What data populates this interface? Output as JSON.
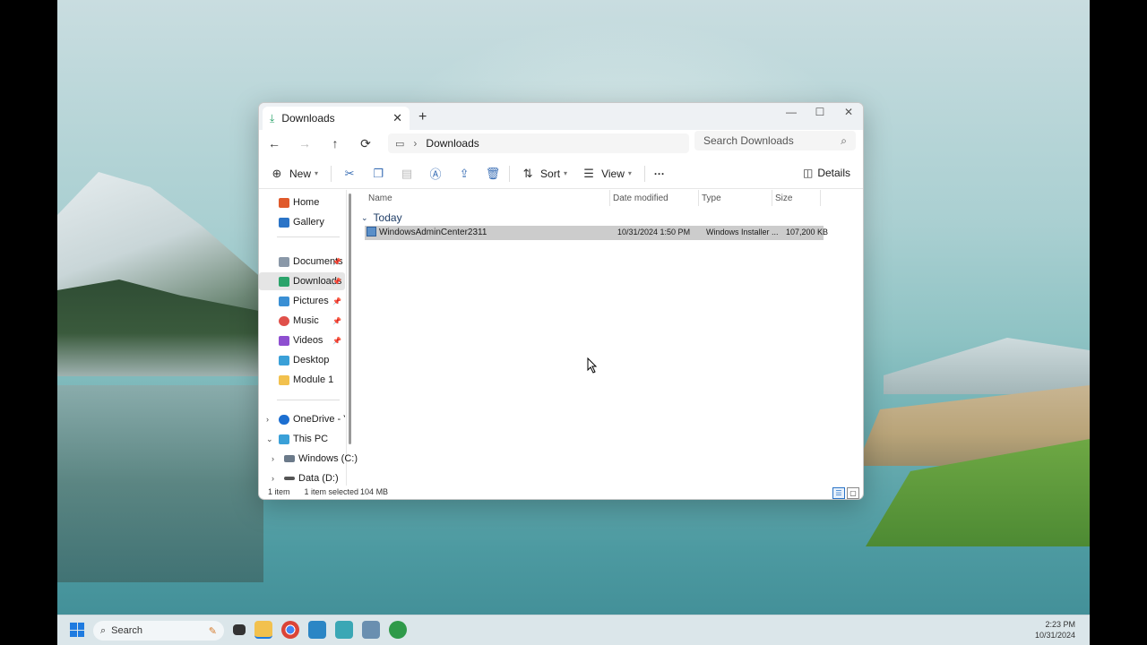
{
  "window": {
    "tab_title": "Downloads",
    "close_tab": "✕",
    "new_tab": "+",
    "minimize": "—",
    "maximize": "☐",
    "close": "✕"
  },
  "address": {
    "back": "←",
    "forward": "→",
    "up": "↑",
    "refresh": "⟳",
    "path": [
      "Downloads"
    ],
    "search_placeholder": "Search Downloads"
  },
  "toolbar": {
    "new_label": "New",
    "sort_label": "Sort",
    "view_label": "View",
    "more_label": "···",
    "details_label": "Details"
  },
  "sidebar": {
    "items": [
      {
        "label": "Home",
        "color": "#e05a2b"
      },
      {
        "label": "Gallery",
        "color": "#2b74c7"
      },
      {
        "label": "Documents",
        "color": "#8a98a8"
      },
      {
        "label": "Downloads",
        "color": "#2aa36a"
      },
      {
        "label": "Pictures",
        "color": "#3a8fd4"
      },
      {
        "label": "Music",
        "color": "#e0504a"
      },
      {
        "label": "Videos",
        "color": "#8e4fd0"
      },
      {
        "label": "Desktop",
        "color": "#3aa0d8"
      },
      {
        "label": "Module 1",
        "color": "#f2c14e"
      },
      {
        "label": "OneDrive - Yakir",
        "color": "#1c6fd1"
      },
      {
        "label": "This PC",
        "color": "#3aa0d8"
      },
      {
        "label": "Windows (C:)",
        "color": "#6b7a8a"
      },
      {
        "label": "Data (D:)",
        "color": "#555555"
      }
    ]
  },
  "main": {
    "columns": {
      "name": "Name",
      "date": "Date modified",
      "type": "Type",
      "size": "Size"
    },
    "group_label": "Today",
    "files": [
      {
        "name": "WindowsAdminCenter2311",
        "date": "10/31/2024 1:50 PM",
        "type": "Windows Installer ...",
        "size": "107,200 KB"
      }
    ]
  },
  "status": {
    "count": "1 item",
    "selected": "1 item selected",
    "size": "104 MB"
  },
  "taskbar": {
    "search_label": "Search",
    "time": "2:23 PM",
    "date": "10/31/2024"
  }
}
